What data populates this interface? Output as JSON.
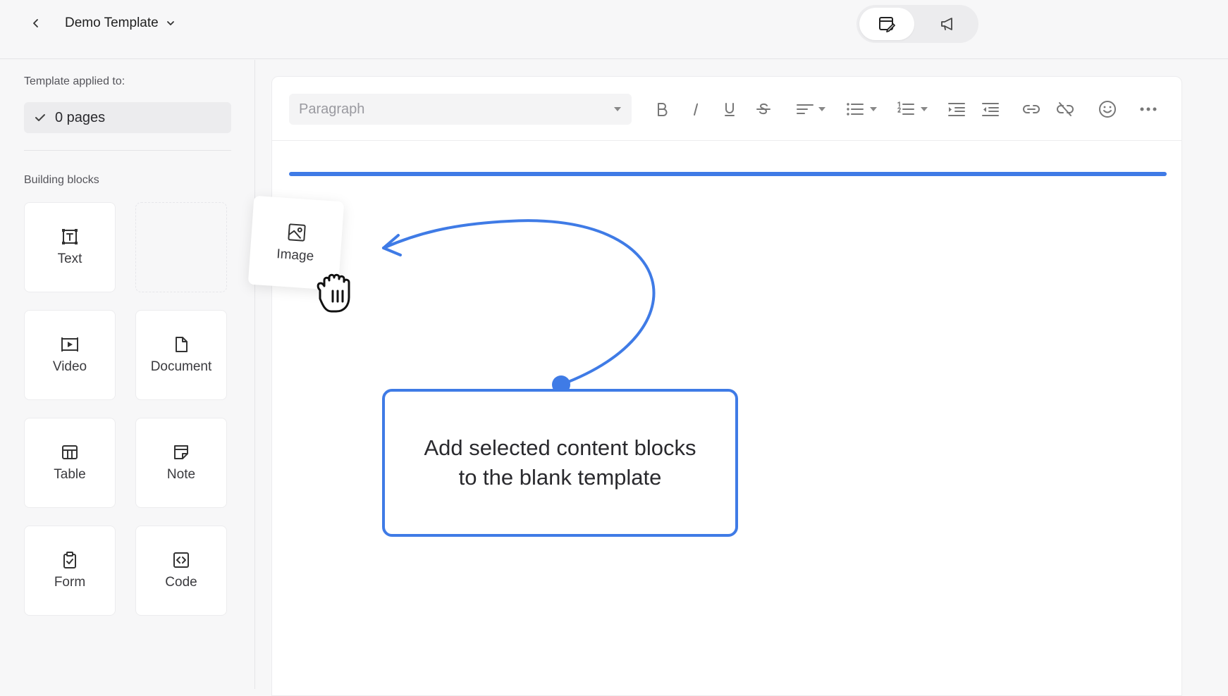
{
  "header": {
    "title": "Demo Template",
    "back_icon": "chevron-left-icon",
    "title_dropdown_icon": "chevron-down-icon",
    "mode_toggle": [
      {
        "icon": "edit-layout-icon",
        "active": true
      },
      {
        "icon": "megaphone-icon",
        "active": false
      }
    ]
  },
  "sidebar": {
    "applied_label": "Template applied to:",
    "applied_value": "0 pages",
    "blocks_label": "Building blocks",
    "blocks": [
      {
        "label": "Text",
        "icon": "text-box-icon"
      },
      {
        "label": "Video",
        "icon": "video-icon"
      },
      {
        "label": "Document",
        "icon": "document-icon"
      },
      {
        "label": "Table",
        "icon": "table-icon"
      },
      {
        "label": "Note",
        "icon": "note-icon"
      },
      {
        "label": "Form",
        "icon": "clipboard-check-icon"
      },
      {
        "label": "Code",
        "icon": "code-icon"
      }
    ]
  },
  "editor": {
    "paragraph_placeholder": "Paragraph",
    "toolbar": [
      "bold-icon",
      "italic-icon",
      "underline-icon",
      "strikethrough-icon",
      "align-icon",
      "bullet-list-icon",
      "numbered-list-icon",
      "indent-icon",
      "outdent-icon",
      "link-icon",
      "unlink-icon",
      "emoji-icon",
      "more-icon"
    ]
  },
  "dragging_block": {
    "label": "Image",
    "icon": "image-icon"
  },
  "callout": {
    "text": "Add selected content blocks to the blank template",
    "accent_color": "#3f7be6"
  }
}
